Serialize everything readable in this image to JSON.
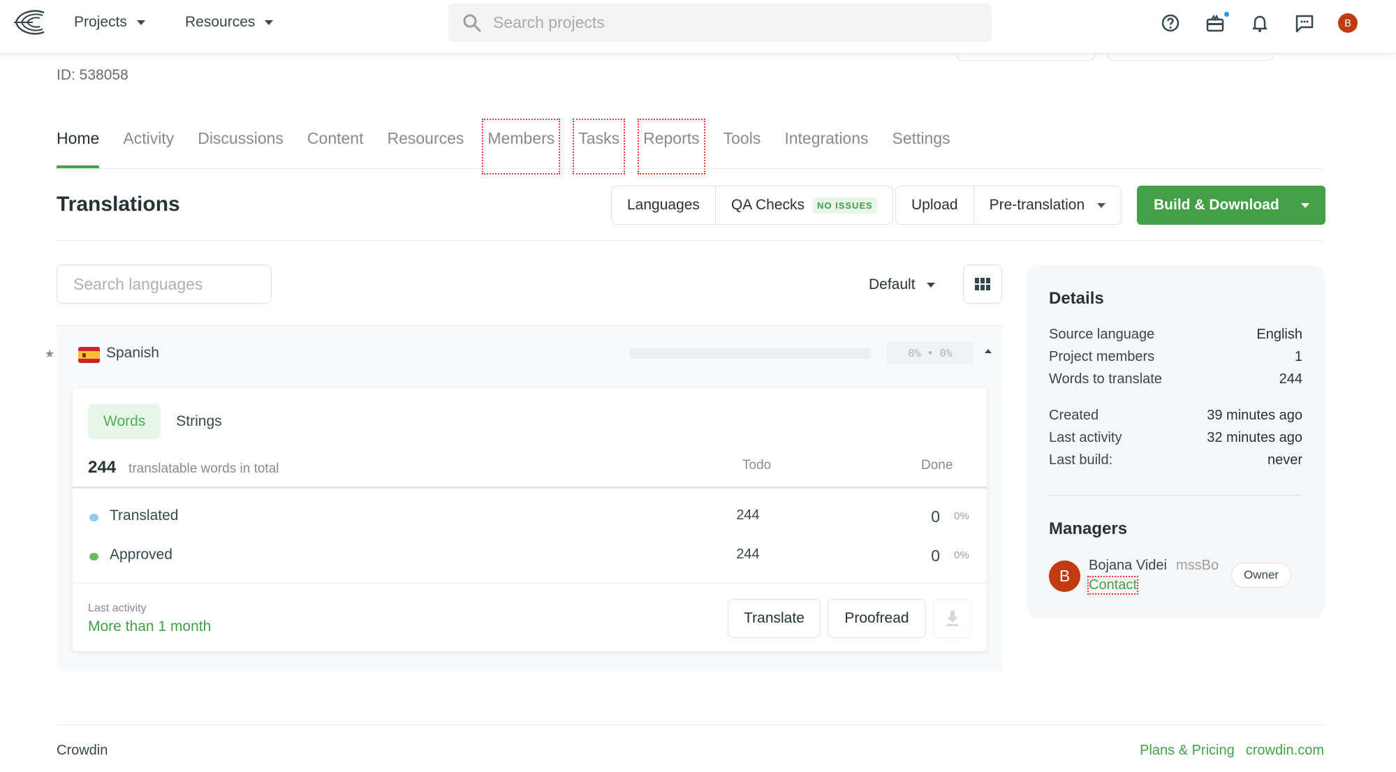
{
  "topbar": {
    "nav": [
      {
        "label": "Projects"
      },
      {
        "label": "Resources"
      }
    ],
    "search_placeholder": "Search projects",
    "icons": [
      "help-icon",
      "gift-icon",
      "bell-icon",
      "chat-icon"
    ],
    "user_initial": "B",
    "gift_has_notification": true
  },
  "project": {
    "id_label": "ID: 538058"
  },
  "tabs": [
    {
      "label": "Home",
      "active": true
    },
    {
      "label": "Activity"
    },
    {
      "label": "Discussions"
    },
    {
      "label": "Content"
    },
    {
      "label": "Resources"
    },
    {
      "label": "Members",
      "highlighted": true
    },
    {
      "label": "Tasks",
      "highlighted": true
    },
    {
      "label": "Reports",
      "highlighted": true
    },
    {
      "label": "Tools"
    },
    {
      "label": "Integrations"
    },
    {
      "label": "Settings"
    }
  ],
  "translations": {
    "title": "Translations",
    "buttons": {
      "languages": "Languages",
      "qa_checks": "QA Checks",
      "qa_badge": "NO ISSUES",
      "upload": "Upload",
      "pretranslation": "Pre-translation",
      "build_download": "Build & Download"
    },
    "search_languages_placeholder": "Search languages",
    "sort_value": "Default",
    "languages": [
      {
        "name": "Spanish",
        "flag": "es",
        "translated_progress": 0,
        "approved_progress": 0,
        "progress_text": "0% • 0%",
        "expanded": true,
        "detail": {
          "tabs": [
            {
              "label": "Words",
              "active": true
            },
            {
              "label": "Strings"
            }
          ],
          "total": "244",
          "total_label": "translatable words in total",
          "col_todo": "Todo",
          "col_done": "Done",
          "rows": [
            {
              "label": "Translated",
              "todo": "244",
              "done": "0",
              "pct": "0%",
              "color": "#90caf9"
            },
            {
              "label": "Approved",
              "todo": "244",
              "done": "0",
              "pct": "0%",
              "color": "#66bb6a"
            }
          ],
          "last_activity_label": "Last activity",
          "last_activity_value": "More than 1 month",
          "actions": {
            "translate": "Translate",
            "proofread": "Proofread"
          }
        }
      }
    ]
  },
  "details": {
    "title": "Details",
    "rows": [
      {
        "label": "Source language",
        "value": "English"
      },
      {
        "label": "Project members",
        "value": "1"
      },
      {
        "label": "Words to translate",
        "value": "244"
      },
      {
        "label": "Created",
        "value": "39 minutes ago"
      },
      {
        "label": "Last activity",
        "value": "32 minutes ago"
      },
      {
        "label": "Last build:",
        "value": "never"
      }
    ],
    "managers_title": "Managers",
    "managers": [
      {
        "initial": "B",
        "name": "Bojana Videi",
        "handle": "mssBo",
        "contact": "Contact",
        "role": "Owner"
      }
    ]
  },
  "footer": {
    "brand": "Crowdin",
    "links": [
      "Plans & Pricing",
      "crowdin.com"
    ]
  },
  "colors": {
    "accent": "#43a047",
    "avatar": "#c23a10",
    "notification_dot": "#2196f3"
  }
}
